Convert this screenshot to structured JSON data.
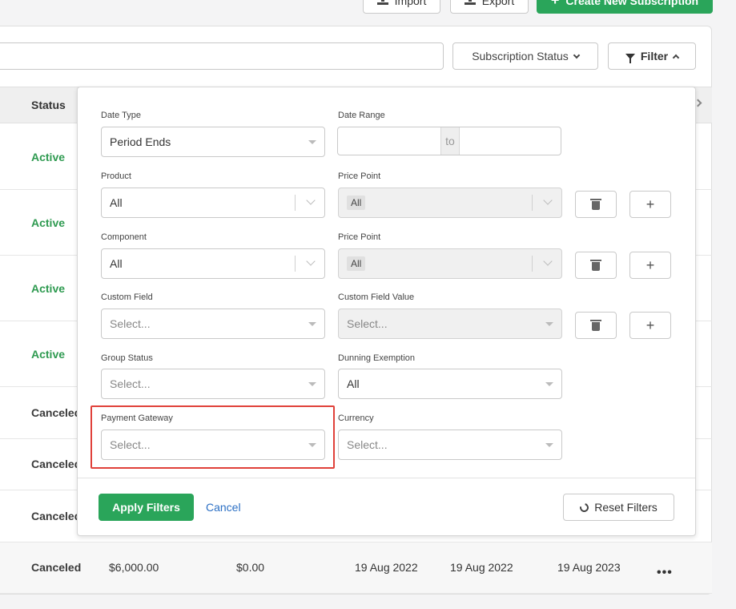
{
  "toolbar": {
    "import_label": "Import",
    "export_label": "Export",
    "create_label": "Create New Subscription",
    "subscription_status_label": "Subscription Status",
    "filter_label": "Filter"
  },
  "table": {
    "status_header": "Status",
    "rows": [
      {
        "status": "Active"
      },
      {
        "status": "Active"
      },
      {
        "status": "Active"
      },
      {
        "status": "Active"
      },
      {
        "status": "Canceled"
      },
      {
        "status": "Canceled"
      },
      {
        "status": "Canceled"
      },
      {
        "status": "Canceled",
        "amount": "$6,000.00",
        "balance": "$0.00",
        "date1": "19 Aug 2022",
        "date2": "19 Aug 2022",
        "date3": "19 Aug 2023",
        "actions": "•••"
      }
    ]
  },
  "filters": {
    "date_type": {
      "label": "Date Type",
      "value": "Period Ends"
    },
    "date_range": {
      "label": "Date Range",
      "to": "to"
    },
    "product": {
      "label": "Product",
      "value": "All"
    },
    "product_price_point": {
      "label": "Price Point",
      "value": "All"
    },
    "component": {
      "label": "Component",
      "value": "All"
    },
    "component_price_point": {
      "label": "Price Point",
      "value": "All"
    },
    "custom_field": {
      "label": "Custom Field",
      "placeholder": "Select..."
    },
    "custom_field_value": {
      "label": "Custom Field Value",
      "placeholder": "Select..."
    },
    "group_status": {
      "label": "Group Status",
      "placeholder": "Select..."
    },
    "dunning_exemption": {
      "label": "Dunning Exemption",
      "value": "All"
    },
    "payment_gateway": {
      "label": "Payment Gateway",
      "placeholder": "Select..."
    },
    "currency": {
      "label": "Currency",
      "placeholder": "Select..."
    },
    "apply_label": "Apply Filters",
    "cancel_label": "Cancel",
    "reset_label": "Reset Filters"
  },
  "colors": {
    "accent_green": "#2aa55a",
    "active_text": "#2e9a50",
    "highlight_red": "#e0413a",
    "link_blue": "#2b6fc4"
  }
}
